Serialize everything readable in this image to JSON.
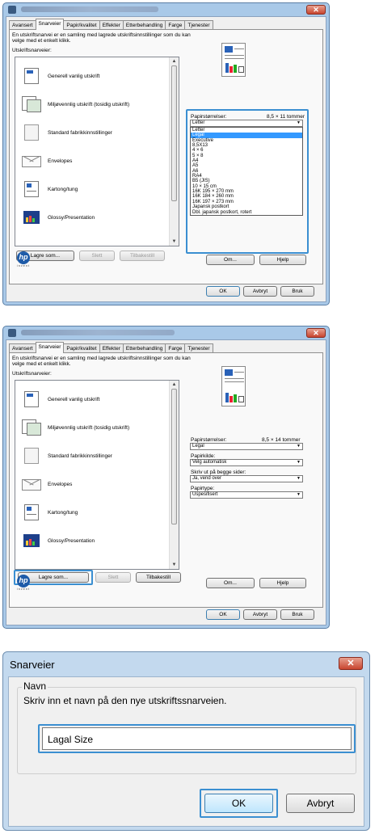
{
  "tabs": [
    "Avansert",
    "Snarveier",
    "Papir/kvalitet",
    "Effekter",
    "Etterbehandling",
    "Farge",
    "Tjenester"
  ],
  "description": "En utskriftsnarvei er en samling med lagrede utskriftsinnstillinger som du kan velge med et enkelt klikk.",
  "description_line1": "En utskriftsnarvei er en samling med lagrede utskriftsinnstillinger som du kan",
  "description_line2": "velge med et enkelt klikk.",
  "shortcuts_label": "Utskriftsnarveier:",
  "shortcuts": [
    {
      "label": "Generell vanlig utskrift",
      "icon": "document-icon"
    },
    {
      "label": "Miljøvennlig utskrift (tosidig utskrift)",
      "icon": "duplex-document-icon"
    },
    {
      "label": "Standard fabrikkinnstillinger",
      "icon": "blank-page-icon"
    },
    {
      "label": "Envelopes",
      "icon": "envelope-icon"
    },
    {
      "label": "Kartong/tung",
      "icon": "cardstock-icon"
    },
    {
      "label": "Glossy/Presentation",
      "icon": "presentation-icon"
    }
  ],
  "buttons": {
    "save_as": "Lagre som...",
    "delete": "Slett",
    "reset": "Tilbakestill",
    "about": "Om...",
    "help": "Hjelp",
    "ok": "OK",
    "cancel": "Avbryt",
    "apply": "Bruk"
  },
  "hp_logo": {
    "mark": "hp",
    "tagline": "invent"
  },
  "dialog1": {
    "paper_sizes_label": "Papirstørrelser:",
    "paper_size_value": "8,5 × 11 tommer",
    "combo_value": "Letter",
    "dropdown_options": [
      "Letter",
      "Legal",
      "Executive",
      "8,5X13",
      "4 × 6",
      "5 × 8",
      "A4",
      "A5",
      "A6",
      "RA4",
      "B5 (JIS)",
      "10 × 15 cm",
      "16K 195 × 270 mm",
      "16K 184 × 260 mm",
      "16K 197 × 273 mm",
      "Japansk postkort",
      "Dbl. japansk postkort, rotert"
    ],
    "selected_option": "Legal"
  },
  "dialog2": {
    "paper_sizes_label": "Papirstørrelser:",
    "paper_size_value": "8,5 × 14 tommer",
    "paper_size_combo": "Legal",
    "source_label": "Papirkilde:",
    "source_value": "Velg automatisk",
    "duplex_label": "Skriv ut på begge sider:",
    "duplex_value": "Ja, vend over",
    "type_label": "Papirtype:",
    "type_value": "Uspesifisert"
  },
  "dialog3": {
    "title": "Snarveier",
    "group_label": "Navn",
    "prompt": "Skriv inn et navn på den nye utskriftssnarveien.",
    "name_value": "Lagal Size",
    "ok": "OK",
    "cancel": "Avbryt"
  },
  "colors": {
    "highlight": "#3b8fd1",
    "selection": "#3399ff",
    "close": "#c8452f",
    "hp_blue": "#1e5ba8"
  }
}
